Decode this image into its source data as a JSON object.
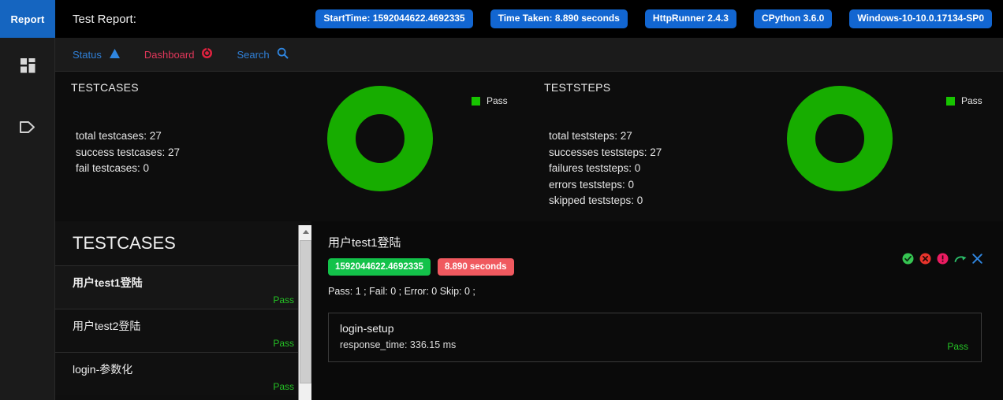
{
  "header": {
    "logo_label": "Report",
    "title": "Test Report:",
    "badges": [
      {
        "label": "StartTime:",
        "value": "1592044622.4692335"
      },
      {
        "label": "Time Taken:",
        "value": "8.890 seconds"
      },
      {
        "label": "HttpRunner",
        "value": "2.4.3"
      },
      {
        "label": "CPython",
        "value": "3.6.0"
      },
      {
        "label": "Windows-10-10.0.17134-SP0",
        "value": ""
      }
    ],
    "accent_blue": "#1266d1",
    "logo_blue": "#1565c0"
  },
  "rail": {
    "items": [
      {
        "icon": "grid-dashboard-icon"
      },
      {
        "icon": "tag-icon"
      }
    ]
  },
  "nav": {
    "items": [
      {
        "label": "Status",
        "icon": "triangle-up-icon",
        "color": "#2f7fd6"
      },
      {
        "label": "Dashboard",
        "icon": "target-icon",
        "color": "#e0375a"
      },
      {
        "label": "Search",
        "icon": "search-icon",
        "color": "#2f7fd6"
      }
    ]
  },
  "stats": {
    "testcases": {
      "heading": "TESTCASES",
      "lines": [
        "total testcases: 27",
        "success testcases: 27",
        "fail testcases: 0"
      ],
      "legend": "Pass"
    },
    "teststeps": {
      "heading": "TESTSTEPS",
      "lines": [
        "total teststeps: 27",
        "successes teststeps: 27",
        "failures teststeps: 0",
        "errors teststeps: 0",
        "skipped teststeps: 0"
      ],
      "legend": "Pass"
    }
  },
  "chart_data": [
    {
      "type": "pie",
      "title": "TESTCASES",
      "labels": [
        "Pass"
      ],
      "values": [
        27
      ],
      "colors": [
        "#17ad00"
      ],
      "legend_position": "top-right",
      "donut": true,
      "total": 27
    },
    {
      "type": "pie",
      "title": "TESTSTEPS",
      "labels": [
        "Pass"
      ],
      "values": [
        27
      ],
      "colors": [
        "#17ad00"
      ],
      "legend_position": "top-right",
      "donut": true,
      "total": 27
    }
  ],
  "case_list": {
    "heading": "TESTCASES",
    "items": [
      {
        "name": "用户test1登陆",
        "status": "Pass"
      },
      {
        "name": "用户test2登陆",
        "status": "Pass"
      },
      {
        "name": "login-参数化",
        "status": "Pass"
      }
    ]
  },
  "detail": {
    "title": "用户test1登陆",
    "chip_time": "1592044622.4692335",
    "chip_duration": "8.890 seconds",
    "counts": "Pass: 1 ; Fail: 0 ; Error: 0 Skip: 0 ;",
    "icons": [
      "check-circle-icon",
      "x-circle-icon",
      "exclamation-circle-icon",
      "redo-arrow-icon",
      "close-x-icon"
    ],
    "steps": [
      {
        "name": "login-setup",
        "meta": "response_time: 336.15 ms",
        "status": "Pass"
      }
    ]
  }
}
